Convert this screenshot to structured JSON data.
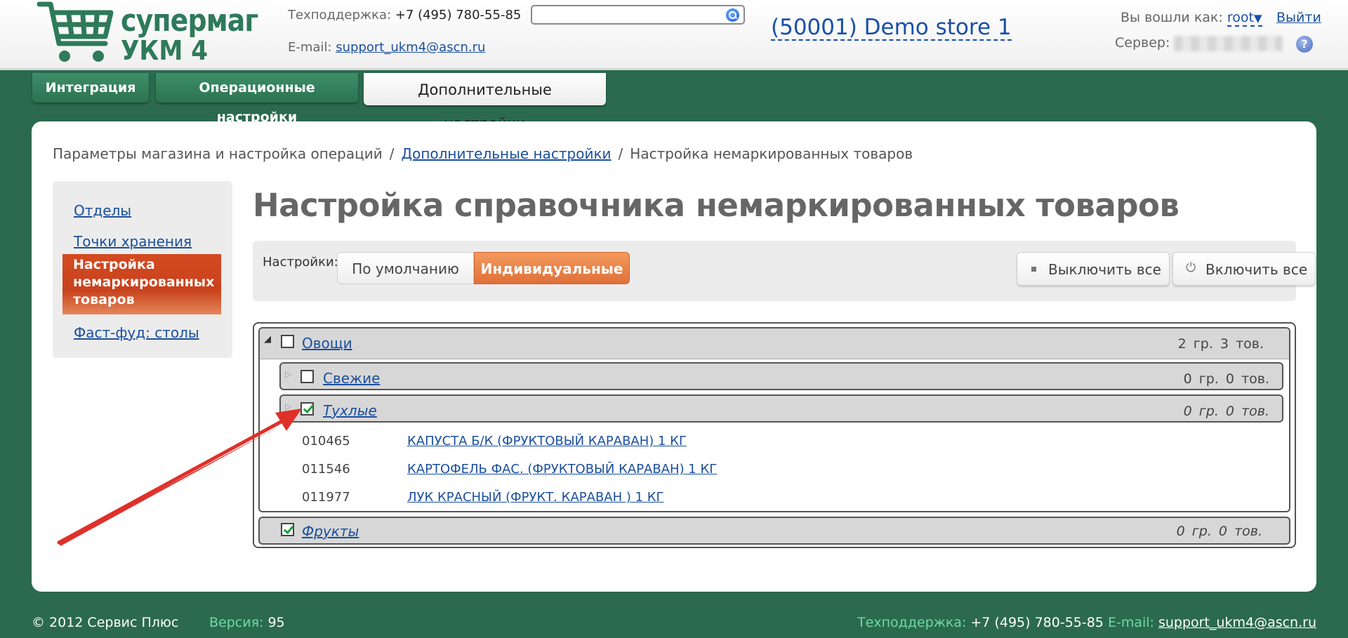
{
  "header": {
    "logo_line1": "супермаг",
    "logo_line2": "УКМ 4",
    "support_label": "Техподдержка:",
    "support_phone": "+7 (495) 780-55-85",
    "email_label": "E-mail:",
    "email": "support_ukm4@ascn.ru",
    "search": {
      "value": "",
      "placeholder": ""
    },
    "store": "(50001) Demo store 1",
    "logged_in_label": "Вы вошли как:",
    "user": "root",
    "logout": "Выйти",
    "server_label": "Сервер:",
    "help": "?"
  },
  "tabs": [
    {
      "label": "Интеграция",
      "active": false
    },
    {
      "label": "Операционные настройки",
      "active": false
    },
    {
      "label": "Дополнительные настройки",
      "active": true
    }
  ],
  "breadcrumb": {
    "item1": "Параметры магазина и настройка операций",
    "item2": "Дополнительные настройки",
    "item3": "Настройка немаркированных товаров",
    "separator": "/"
  },
  "sidebar": {
    "items": [
      {
        "label": "Отделы"
      },
      {
        "label": "Точки хранения"
      },
      {
        "label": "Настройка немаркированных товаров",
        "active": true
      },
      {
        "label": "Фаст-фуд: столы"
      }
    ]
  },
  "page_title": "Настройка справочника немаркированных товаров",
  "toolbar": {
    "label": "Настройки:",
    "mode_default": "По умолчанию",
    "mode_custom": "Индивидуальные",
    "mode_selected": "Индивидуальные",
    "disable_all": "Выключить все",
    "enable_all": "Включить все"
  },
  "tree": {
    "vegetables": {
      "name": "Овощи",
      "groups": "2",
      "items": "3",
      "checked": false,
      "expanded": true
    },
    "fresh": {
      "name": "Свежие",
      "groups": "0",
      "items": "0",
      "checked": false
    },
    "rotten": {
      "name": "Тухлые",
      "groups": "0",
      "items": "0",
      "checked": true
    },
    "products": [
      {
        "code": "010465",
        "name": "КАПУСТА Б/К (ФРУКТОВЫЙ КАРАВАН) 1 КГ"
      },
      {
        "code": "011546",
        "name": "КАРТОФЕЛЬ ФАС. (ФРУКТОВЫЙ КАРАВАН) 1 КГ"
      },
      {
        "code": "011977",
        "name": "ЛУК КРАСНЫЙ (ФРУКТ. КАРАВАН ) 1 КГ"
      }
    ],
    "fruits": {
      "name": "Фрукты",
      "groups": "0",
      "items": "0",
      "checked": true
    },
    "groups_abbr": "гр.",
    "items_abbr": "тов."
  },
  "footer": {
    "copyright": "© 2012 Сервис Плюс",
    "version_label": "Версия:",
    "version": "95",
    "support_label": "Техподдержка:",
    "support_phone": "+7 (495) 780-55-85",
    "email_label": "E-mail:",
    "email": "support_ukm4@ascn.ru"
  },
  "colors": {
    "background": "#2b6a4e",
    "accent_orange": "#e0703a",
    "link": "#1a4f9e",
    "annotation_arrow": "#e0302a"
  }
}
